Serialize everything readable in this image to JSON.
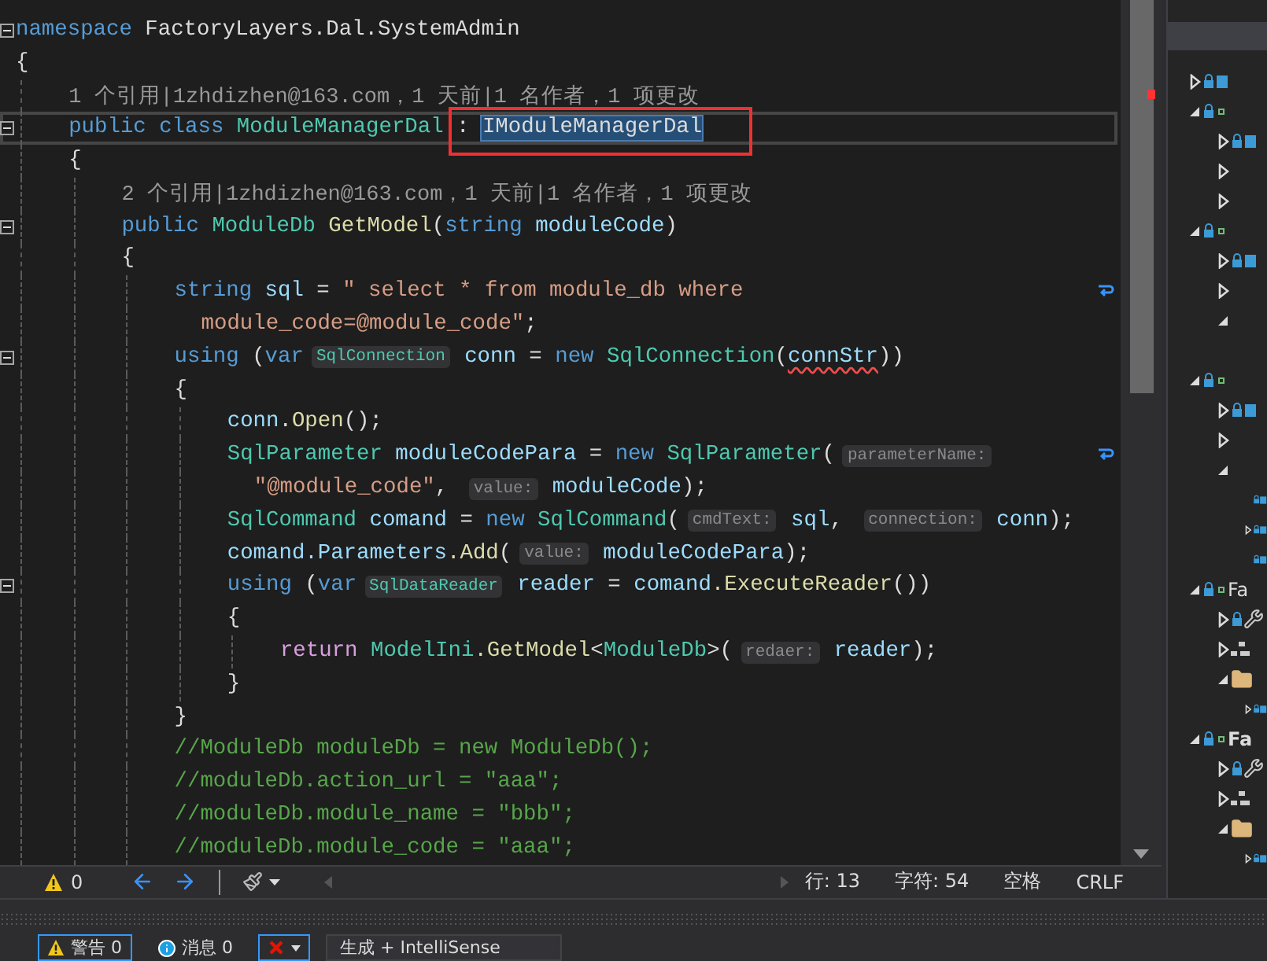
{
  "editor": {
    "lines": [
      {
        "current": false,
        "segments": [
          {
            "kind": "kw",
            "text": "namespace"
          },
          {
            "kind": "plain",
            "text": " FactoryLayers.Dal.SystemAdmin"
          }
        ]
      },
      {
        "current": false,
        "segments": [
          {
            "kind": "plain",
            "text": "{"
          }
        ],
        "children": [
          {
            "current": false,
            "segments": [
              {
                "kind": "lens",
                "text": "1 个引用|1zhdizhen@163.com，1 天前|1 名作者，1 项更改"
              }
            ]
          },
          {
            "current": true,
            "marked": true,
            "segments": [
              {
                "kind": "kw",
                "text": "public class"
              },
              {
                "kind": "type",
                "text": " ModuleManagerDal"
              },
              {
                "kind": "plain",
                "text": " : "
              },
              {
                "kind": "sel",
                "text": "IModuleManagerDal"
              }
            ]
          },
          {
            "current": false,
            "segments": [
              {
                "kind": "plain",
                "text": "{"
              }
            ],
            "children": [
              {
                "current": false,
                "segments": [
                  {
                    "kind": "lens",
                    "text": "2 个引用|1zhdizhen@163.com，1 天前|1 名作者，1 项更改"
                  }
                ]
              },
              {
                "current": false,
                "segments": [
                  {
                    "kind": "kw",
                    "text": "public"
                  },
                  {
                    "kind": "type",
                    "text": " ModuleDb"
                  },
                  {
                    "kind": "method",
                    "text": " GetModel"
                  },
                  {
                    "kind": "plain",
                    "text": "("
                  },
                  {
                    "kind": "kw",
                    "text": "string"
                  },
                  {
                    "kind": "var",
                    "text": " moduleCode"
                  },
                  {
                    "kind": "plain",
                    "text": ")"
                  }
                ]
              },
              {
                "current": false,
                "segments": [
                  {
                    "kind": "plain",
                    "text": "{"
                  }
                ],
                "children": [
                  {
                    "current": false,
                    "segments": [
                      {
                        "kind": "kw",
                        "text": "string"
                      },
                      {
                        "kind": "var",
                        "text": " sql"
                      },
                      {
                        "kind": "plain",
                        "text": " = "
                      },
                      {
                        "kind": "str",
                        "text": "\" select * from module_db where"
                      }
                    ],
                    "wrap": [
                      {
                        "kind": "str",
                        "text": "module_code=@module_code\""
                      },
                      {
                        "kind": "plain",
                        "text": ";"
                      }
                    ]
                  },
                  {
                    "current": false,
                    "segments": [
                      {
                        "kind": "kw",
                        "text": "using"
                      },
                      {
                        "kind": "plain",
                        "text": " ("
                      },
                      {
                        "kind": "kw",
                        "text": "var"
                      },
                      {
                        "kind": "thint",
                        "text": "SqlConnection"
                      },
                      {
                        "kind": "var",
                        "text": " conn"
                      },
                      {
                        "kind": "plain",
                        "text": " = "
                      },
                      {
                        "kind": "kw",
                        "text": "new"
                      },
                      {
                        "kind": "type",
                        "text": " SqlConnection"
                      },
                      {
                        "kind": "plain",
                        "text": "("
                      },
                      {
                        "kind": "err",
                        "text": "connStr"
                      },
                      {
                        "kind": "plain",
                        "text": "))"
                      }
                    ]
                  },
                  {
                    "current": false,
                    "segments": [
                      {
                        "kind": "plain",
                        "text": "{"
                      }
                    ],
                    "children": [
                      {
                        "current": false,
                        "segments": [
                          {
                            "kind": "var",
                            "text": "conn"
                          },
                          {
                            "kind": "plain",
                            "text": "."
                          },
                          {
                            "kind": "method",
                            "text": "Open"
                          },
                          {
                            "kind": "plain",
                            "text": "();"
                          }
                        ]
                      },
                      {
                        "current": false,
                        "segments": [
                          {
                            "kind": "type",
                            "text": "SqlParameter"
                          },
                          {
                            "kind": "var",
                            "text": " moduleCodePara"
                          },
                          {
                            "kind": "plain",
                            "text": " = "
                          },
                          {
                            "kind": "kw",
                            "text": "new"
                          },
                          {
                            "kind": "type",
                            "text": " SqlParameter"
                          },
                          {
                            "kind": "plain",
                            "text": "("
                          },
                          {
                            "kind": "hint",
                            "text": "parameterName:"
                          }
                        ],
                        "wrap": [
                          {
                            "kind": "str",
                            "text": "\"@module_code\""
                          },
                          {
                            "kind": "plain",
                            "text": ", "
                          },
                          {
                            "kind": "hint",
                            "text": "value:"
                          },
                          {
                            "kind": "var",
                            "text": " moduleCode"
                          },
                          {
                            "kind": "plain",
                            "text": ");"
                          }
                        ]
                      },
                      {
                        "current": false,
                        "segments": [
                          {
                            "kind": "type",
                            "text": "SqlCommand"
                          },
                          {
                            "kind": "var",
                            "text": " comand"
                          },
                          {
                            "kind": "plain",
                            "text": " = "
                          },
                          {
                            "kind": "kw",
                            "text": "new"
                          },
                          {
                            "kind": "type",
                            "text": " SqlCommand"
                          },
                          {
                            "kind": "plain",
                            "text": "("
                          },
                          {
                            "kind": "hint",
                            "text": "cmdText:"
                          },
                          {
                            "kind": "var",
                            "text": " sql"
                          },
                          {
                            "kind": "plain",
                            "text": ", "
                          },
                          {
                            "kind": "hint",
                            "text": "connection:"
                          },
                          {
                            "kind": "var",
                            "text": " conn"
                          },
                          {
                            "kind": "plain",
                            "text": ");"
                          }
                        ]
                      },
                      {
                        "current": false,
                        "segments": [
                          {
                            "kind": "var",
                            "text": "comand.Parameters"
                          },
                          {
                            "kind": "method",
                            "text": ".Add"
                          },
                          {
                            "kind": "plain",
                            "text": "("
                          },
                          {
                            "kind": "hint",
                            "text": "value:"
                          },
                          {
                            "kind": "var",
                            "text": " moduleCodePara"
                          },
                          {
                            "kind": "plain",
                            "text": ");"
                          }
                        ]
                      },
                      {
                        "current": false,
                        "segments": [
                          {
                            "kind": "kw",
                            "text": "using"
                          },
                          {
                            "kind": "plain",
                            "text": " ("
                          },
                          {
                            "kind": "kw",
                            "text": "var"
                          },
                          {
                            "kind": "thint",
                            "text": "SqlDataReader"
                          },
                          {
                            "kind": "var",
                            "text": " reader"
                          },
                          {
                            "kind": "plain",
                            "text": " = "
                          },
                          {
                            "kind": "var",
                            "text": "comand"
                          },
                          {
                            "kind": "method",
                            "text": ".ExecuteReader"
                          },
                          {
                            "kind": "plain",
                            "text": "())"
                          }
                        ]
                      },
                      {
                        "current": false,
                        "segments": [
                          {
                            "kind": "plain",
                            "text": "{"
                          }
                        ],
                        "children": [
                          {
                            "current": false,
                            "segments": [
                              {
                                "kind": "ctl",
                                "text": "return"
                              },
                              {
                                "kind": "type",
                                "text": " ModelIni"
                              },
                              {
                                "kind": "method",
                                "text": ".GetModel"
                              },
                              {
                                "kind": "plain",
                                "text": "<"
                              },
                              {
                                "kind": "type",
                                "text": "ModuleDb"
                              },
                              {
                                "kind": "plain",
                                "text": ">("
                              },
                              {
                                "kind": "hint",
                                "text": "redaer:"
                              },
                              {
                                "kind": "var",
                                "text": " reader"
                              },
                              {
                                "kind": "plain",
                                "text": ");"
                              }
                            ]
                          }
                        ]
                      },
                      {
                        "current": false,
                        "segments": [
                          {
                            "kind": "plain",
                            "text": "}"
                          }
                        ]
                      }
                    ]
                  },
                  {
                    "current": false,
                    "segments": [
                      {
                        "kind": "plain",
                        "text": "}"
                      }
                    ]
                  },
                  {
                    "current": false,
                    "segments": [
                      {
                        "kind": "cmt",
                        "text": "//ModuleDb moduleDb = new ModuleDb();"
                      }
                    ]
                  },
                  {
                    "current": false,
                    "segments": [
                      {
                        "kind": "cmt",
                        "text": "//moduleDb.action_url = \"aaa\";"
                      }
                    ]
                  },
                  {
                    "current": false,
                    "segments": [
                      {
                        "kind": "cmt",
                        "text": "//moduleDb.module_name = \"bbb\";"
                      }
                    ]
                  },
                  {
                    "current": false,
                    "segments": [
                      {
                        "kind": "cmt",
                        "text": "//moduleDb.module_code = \"aaa\";"
                      }
                    ]
                  }
                ]
              }
            ]
          }
        ]
      }
    ]
  },
  "status_bar": {
    "warnings": "0",
    "line": "行: 13",
    "column": "字符: 54",
    "indent": "空格",
    "line_ending": "CRLF"
  },
  "solution_explorer": {
    "items": [
      {
        "kind": "file",
        "expanded": false
      },
      {
        "kind": "project",
        "expanded": true,
        "children": [
          {
            "kind": "file",
            "expanded": false
          },
          {
            "kind": "node",
            "expanded": false
          },
          {
            "kind": "node",
            "expanded": false
          }
        ]
      },
      {
        "kind": "project",
        "expanded": true,
        "children": [
          {
            "kind": "file",
            "expanded": false
          },
          {
            "kind": "node",
            "expanded": false
          },
          {
            "kind": "node",
            "expanded": true
          }
        ]
      },
      {
        "kind": "blank"
      },
      {
        "kind": "project",
        "expanded": true,
        "children": [
          {
            "kind": "file",
            "expanded": false
          },
          {
            "kind": "node",
            "expanded": false
          },
          {
            "kind": "node",
            "expanded": true,
            "children": [
              {
                "kind": "file"
              },
              {
                "kind": "file",
                "expanded": false
              },
              {
                "kind": "file"
              }
            ]
          }
        ]
      },
      {
        "kind": "project",
        "expanded": true,
        "label": "Fa",
        "startup": false,
        "children": [
          {
            "kind": "properties",
            "expanded": false
          },
          {
            "kind": "references",
            "expanded": false
          },
          {
            "kind": "folder",
            "expanded": true,
            "children": [
              {
                "kind": "file",
                "expanded": false
              }
            ]
          }
        ]
      },
      {
        "kind": "project",
        "expanded": true,
        "label": "Fa",
        "startup": true,
        "children": [
          {
            "kind": "properties",
            "expanded": false
          },
          {
            "kind": "references",
            "expanded": false
          },
          {
            "kind": "folder",
            "expanded": true,
            "children": [
              {
                "kind": "file",
                "expanded": false
              }
            ]
          }
        ]
      }
    ]
  },
  "error_list": {
    "buttons": [
      {
        "kind": "warning",
        "label": "警告 0",
        "selected": true
      },
      {
        "kind": "info",
        "label": "消息 0",
        "selected": false
      },
      {
        "kind": "filter",
        "selected": true
      }
    ],
    "scope": "生成 + IntelliSense"
  }
}
